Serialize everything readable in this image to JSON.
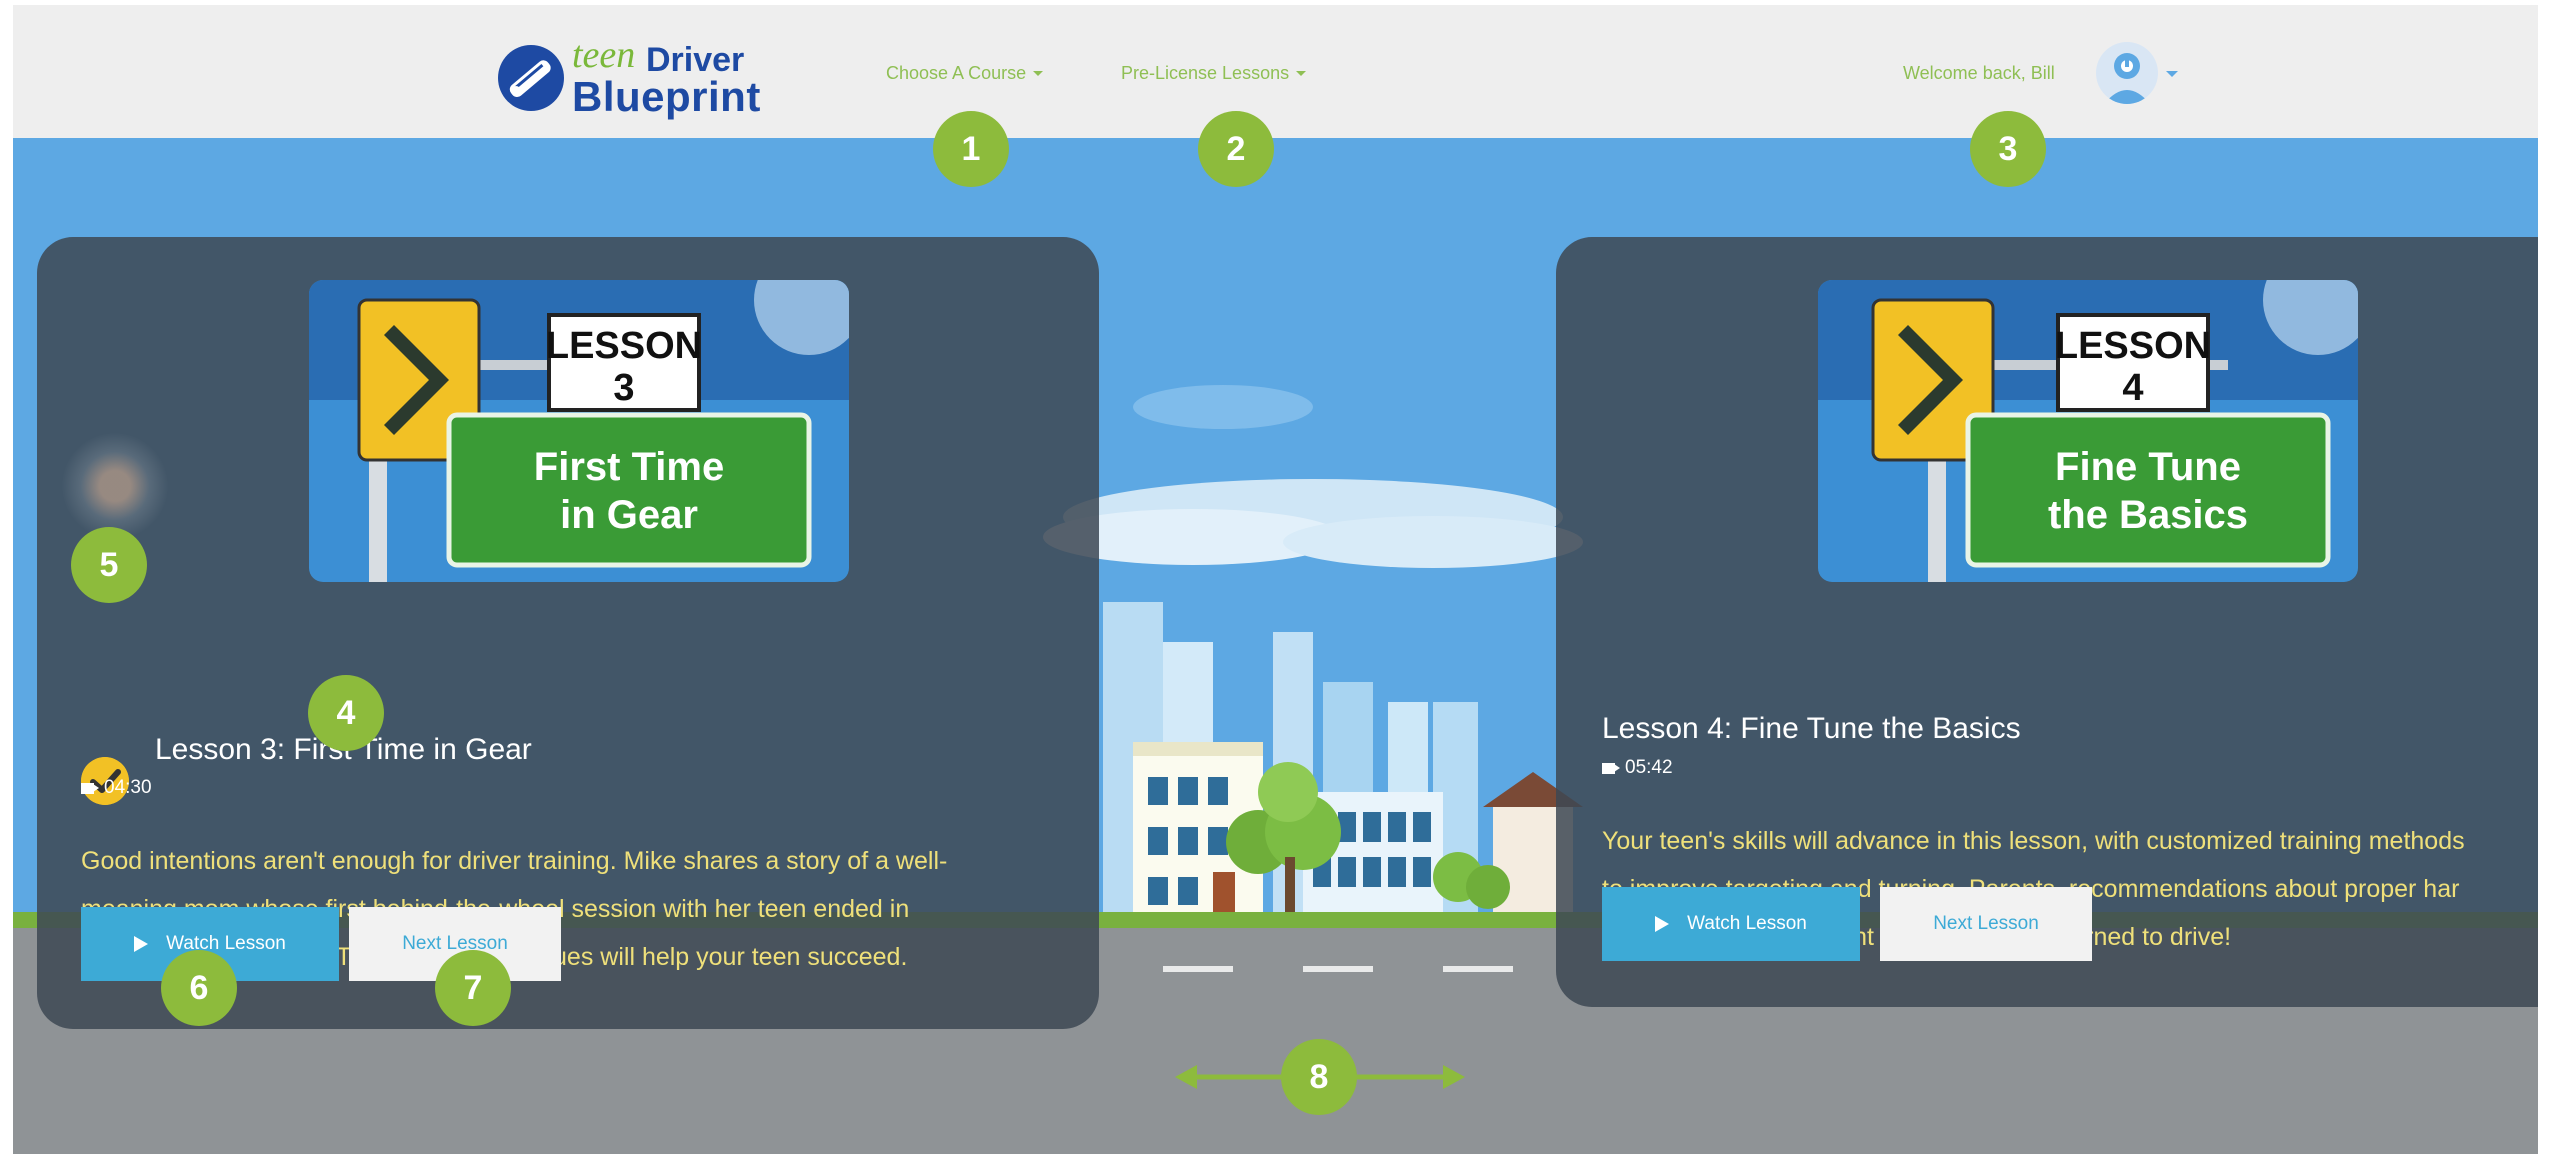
{
  "header": {
    "logo": {
      "teen": "teen",
      "driver": "Driver",
      "blueprint": "Blueprint"
    },
    "nav": [
      {
        "label": "Choose A Course"
      },
      {
        "label": "Pre-License Lessons"
      }
    ],
    "welcome": "Welcome back, Bill"
  },
  "lessons": [
    {
      "thumb_lesson_word": "LESSON",
      "thumb_number": "3",
      "thumb_line1": "First Time",
      "thumb_line2": "in Gear",
      "title": "Lesson 3: First Time in Gear",
      "duration": "04:30",
      "completed": true,
      "desc_lines": [
        "Good intentions aren't enough for driver training. Mike shares a story of a well-",
        "meaning mom whose first behind-the-wheel session with her teen ended in",
        "injury for both of them. These easy techniques will help your teen succeed."
      ],
      "watch_label": "Watch Lesson",
      "next_label": "Next Lesson"
    },
    {
      "thumb_lesson_word": "LESSON",
      "thumb_number": "4",
      "thumb_line1": "Fine Tune",
      "thumb_line2": "the Basics",
      "title": "Lesson 4: Fine Tune the Basics",
      "duration": "05:42",
      "completed": false,
      "desc_lines": [
        "Your teen's skills will advance in this lesson, with customized training methods",
        "to improve targeting and turning. Parents, recommendations about proper har",
        "position may be different from when you learned to drive!"
      ],
      "watch_label": "Watch Lesson",
      "next_label": "Next Lesson"
    }
  ],
  "markers": [
    "1",
    "2",
    "3",
    "4",
    "5",
    "6",
    "7",
    "8"
  ],
  "colors": {
    "nav_bg": "#eeeeee",
    "sky": "#5da8e3",
    "card": "#3e4854",
    "accent_green": "#8dbb3c",
    "button_blue": "#3daad6",
    "desc_text": "#efe07a",
    "brand_blue": "#1e4aa3"
  }
}
